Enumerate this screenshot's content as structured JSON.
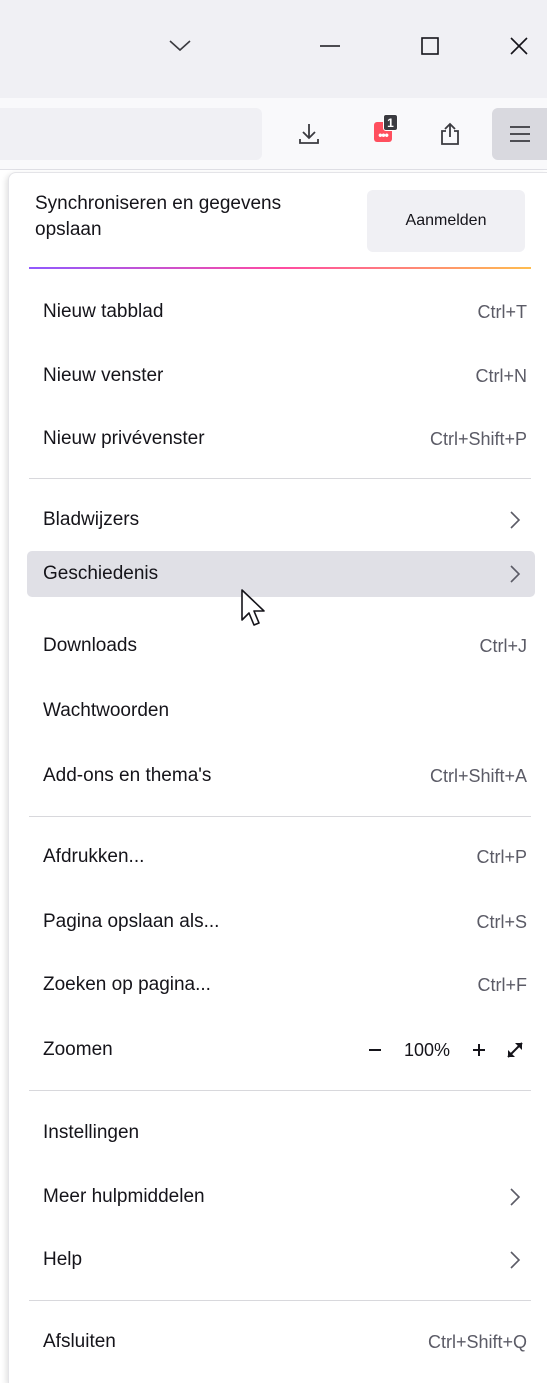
{
  "titlebar": {
    "icons": [
      "chevron-down-icon",
      "minimize-icon",
      "maximize-icon",
      "close-icon"
    ]
  },
  "toolbar": {
    "icons": [
      "download-icon",
      "extension-icon",
      "share-icon",
      "hamburger-menu-icon"
    ],
    "extension_badge": "1",
    "extension_dots": "•••"
  },
  "menu": {
    "sync": {
      "text": "Synchroniseren en gegevens opslaan",
      "button": "Aanmelden"
    },
    "groups": {
      "new": [
        {
          "label": "Nieuw tabblad",
          "shortcut": "Ctrl+T"
        },
        {
          "label": "Nieuw venster",
          "shortcut": "Ctrl+N"
        },
        {
          "label": "Nieuw privévenster",
          "shortcut": "Ctrl+Shift+P"
        }
      ],
      "library": [
        {
          "label": "Bladwijzers",
          "submenu": true
        },
        {
          "label": "Geschiedenis",
          "submenu": true,
          "hovered": true
        },
        {
          "label": "Downloads",
          "shortcut": "Ctrl+J"
        },
        {
          "label": "Wachtwoorden"
        },
        {
          "label": "Add-ons en thema's",
          "shortcut": "Ctrl+Shift+A"
        }
      ],
      "page": [
        {
          "label": "Afdrukken...",
          "shortcut": "Ctrl+P"
        },
        {
          "label": "Pagina opslaan als...",
          "shortcut": "Ctrl+S"
        },
        {
          "label": "Zoeken op pagina...",
          "shortcut": "Ctrl+F"
        }
      ],
      "zoom": {
        "label": "Zoomen",
        "value": "100%",
        "minus": "−",
        "plus": "+"
      },
      "tools": [
        {
          "label": "Instellingen"
        },
        {
          "label": "Meer hulpmiddelen",
          "submenu": true
        },
        {
          "label": "Help",
          "submenu": true
        }
      ],
      "quit": {
        "label": "Afsluiten",
        "shortcut": "Ctrl+Shift+Q"
      }
    }
  },
  "colors": {
    "titlebar_bg": "#f0f0f4",
    "toolbar_bg": "#f9f9fb",
    "hover_bg": "#e0e0e6",
    "badge_red": "#ff4f5e"
  }
}
